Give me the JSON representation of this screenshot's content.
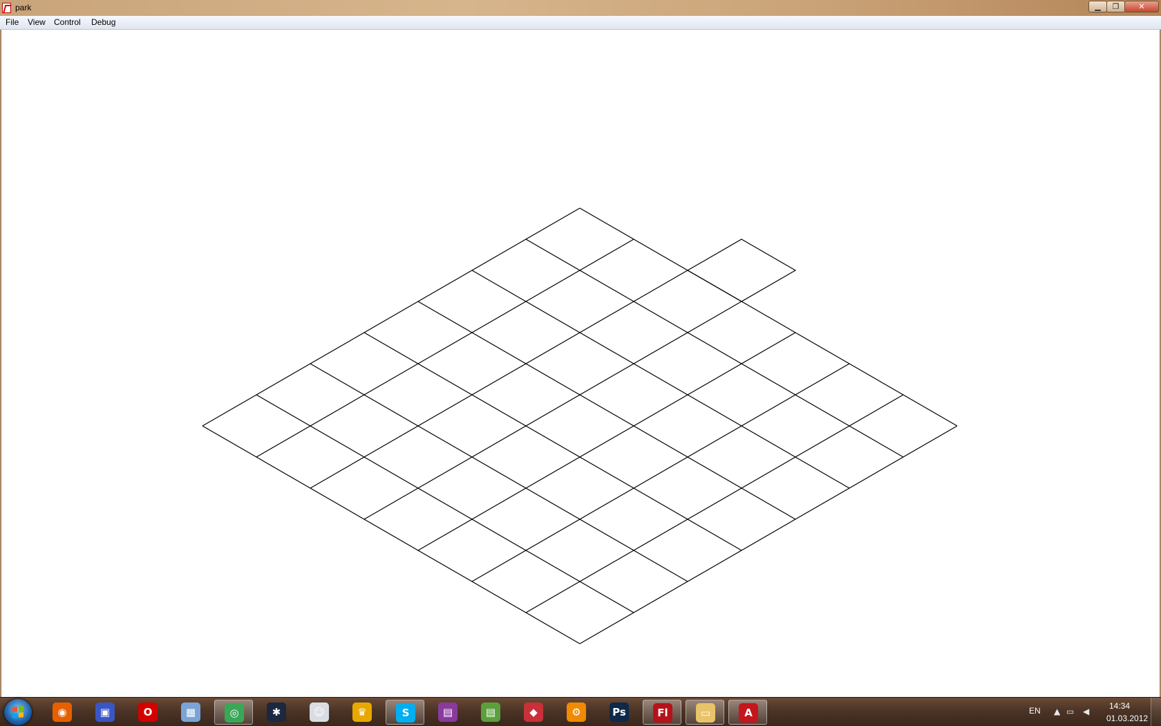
{
  "window": {
    "title": "park",
    "app_icon": "flash-player-icon"
  },
  "menubar": {
    "items": [
      "File",
      "View",
      "Control",
      "Debug"
    ]
  },
  "stage": {
    "content": "isometric-grid",
    "grid": {
      "rows": 7,
      "cols": 7,
      "line_color": "#000000",
      "background": "#ffffff"
    },
    "cursor_tile": {
      "row": -1,
      "col": 2
    }
  },
  "taskbar": {
    "pinned": [
      {
        "name": "firefox",
        "icon": "firefox-icon",
        "color": "#e66000",
        "glyph": "◉"
      },
      {
        "name": "save",
        "icon": "floppy-disk-icon",
        "color": "#3a56c4",
        "glyph": "▣"
      },
      {
        "name": "opera",
        "icon": "opera-icon",
        "color": "#d40000",
        "glyph": "O"
      },
      {
        "name": "calculator",
        "icon": "calculator-icon",
        "color": "#7aa4d6",
        "glyph": "▦"
      },
      {
        "name": "chrome",
        "icon": "chrome-icon",
        "color": "#3aa757",
        "glyph": "◎",
        "active": true
      },
      {
        "name": "fan-app",
        "icon": "fan-icon",
        "color": "#1b2840",
        "glyph": "✱"
      },
      {
        "name": "headset-app",
        "icon": "headset-icon",
        "color": "#d9dde3",
        "glyph": "☺"
      },
      {
        "name": "crown-app",
        "icon": "crown-icon",
        "color": "#e8a800",
        "glyph": "♛"
      },
      {
        "name": "skype",
        "icon": "skype-icon",
        "color": "#00aff0",
        "glyph": "S",
        "active": true
      },
      {
        "name": "winrar",
        "icon": "winrar-icon",
        "color": "#8a3a9c",
        "glyph": "▤"
      },
      {
        "name": "archive-app",
        "icon": "archive-icon",
        "color": "#5aa03c",
        "glyph": "▤"
      },
      {
        "name": "red-app",
        "icon": "red-app-icon",
        "color": "#c8313a",
        "glyph": "◆"
      },
      {
        "name": "settings-app",
        "icon": "gear-icon",
        "color": "#f08a00",
        "glyph": "⚙"
      },
      {
        "name": "photoshop",
        "icon": "photoshop-icon",
        "color": "#0d2a4a",
        "glyph": "Ps"
      },
      {
        "name": "flash",
        "icon": "flash-icon",
        "color": "#b5121b",
        "glyph": "Fl",
        "active": true
      },
      {
        "name": "explorer",
        "icon": "folder-icon",
        "color": "#e8c36a",
        "glyph": "▭",
        "active": true
      },
      {
        "name": "acrobat",
        "icon": "acrobat-icon",
        "color": "#c4161c",
        "glyph": "A",
        "active": true
      }
    ],
    "tray": {
      "language": "EN",
      "time": "14:34",
      "date": "01.03.2012"
    }
  }
}
